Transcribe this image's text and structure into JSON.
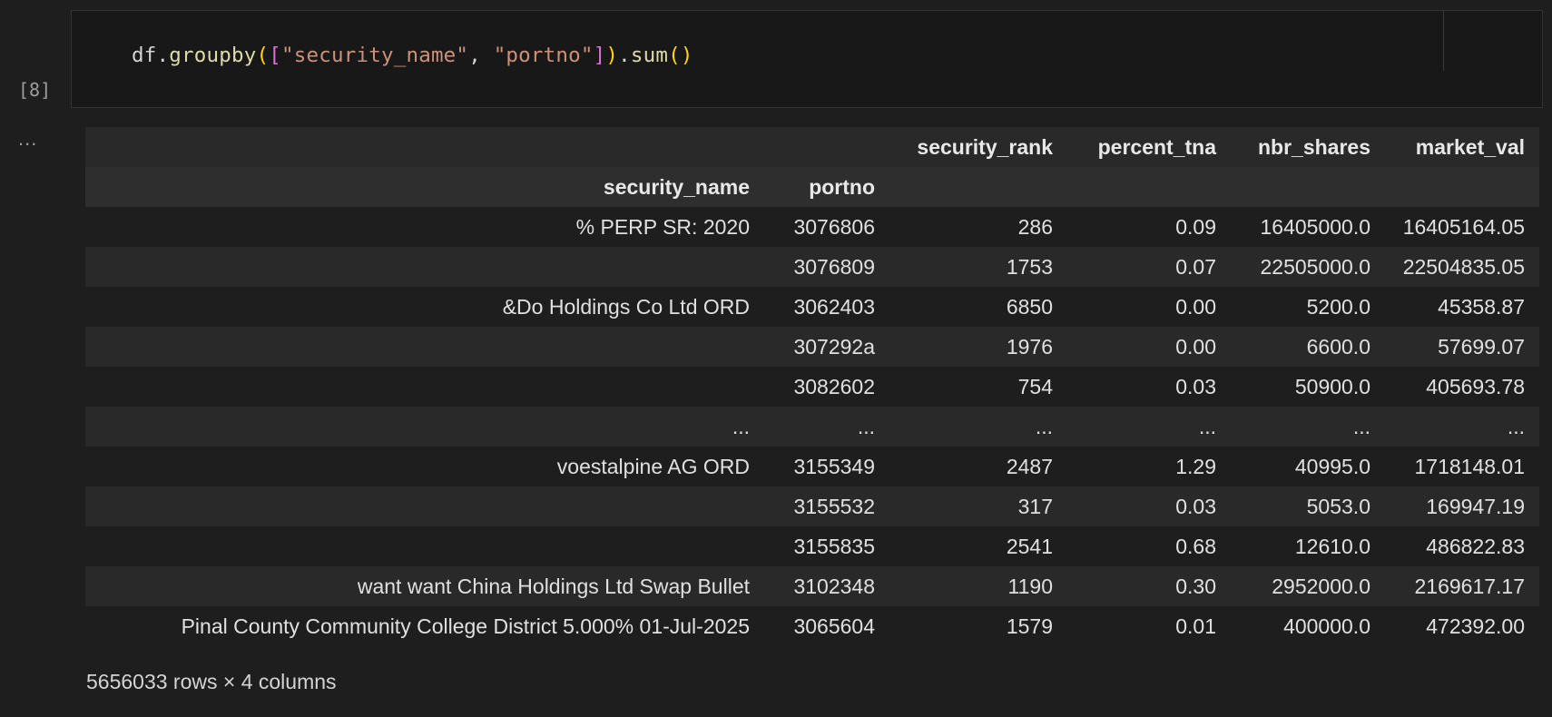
{
  "cell": {
    "execution_count": "[8]",
    "output_marker": "...",
    "code_tokens": {
      "t1": "df.",
      "t2": "groupby",
      "t3": "(",
      "t4": "[",
      "t5": "\"security_name\"",
      "t6": ", ",
      "t7": "\"portno\"",
      "t8": "]",
      "t9": ")",
      "t10": ".",
      "t11": "sum",
      "t12": "()"
    }
  },
  "dataframe": {
    "columns": [
      "security_rank",
      "percent_tna",
      "nbr_shares",
      "market_val"
    ],
    "index_names": [
      "security_name",
      "portno"
    ],
    "rows": [
      {
        "security_name": "% PERP SR: 2020",
        "portno": "3076806",
        "values": [
          "286",
          "0.09",
          "16405000.0",
          "16405164.05"
        ]
      },
      {
        "security_name": "",
        "portno": "3076809",
        "values": [
          "1753",
          "0.07",
          "22505000.0",
          "22504835.05"
        ]
      },
      {
        "security_name": "&Do Holdings Co Ltd ORD",
        "portno": "3062403",
        "values": [
          "6850",
          "0.00",
          "5200.0",
          "45358.87"
        ]
      },
      {
        "security_name": "",
        "portno": "307292a",
        "values": [
          "1976",
          "0.00",
          "6600.0",
          "57699.07"
        ]
      },
      {
        "security_name": "",
        "portno": "3082602",
        "values": [
          "754",
          "0.03",
          "50900.0",
          "405693.78"
        ]
      },
      {
        "security_name": "...",
        "portno": "...",
        "values": [
          "...",
          "...",
          "...",
          "..."
        ]
      },
      {
        "security_name": "voestalpine AG ORD",
        "portno": "3155349",
        "values": [
          "2487",
          "1.29",
          "40995.0",
          "1718148.01"
        ]
      },
      {
        "security_name": "",
        "portno": "3155532",
        "values": [
          "317",
          "0.03",
          "5053.0",
          "169947.19"
        ]
      },
      {
        "security_name": "",
        "portno": "3155835",
        "values": [
          "2541",
          "0.68",
          "12610.0",
          "486822.83"
        ]
      },
      {
        "security_name": "want want China Holdings Ltd Swap Bullet",
        "portno": "3102348",
        "values": [
          "1190",
          "0.30",
          "2952000.0",
          "2169617.17"
        ]
      },
      {
        "security_name": "Pinal County Community College District 5.000% 01-Jul-2025",
        "portno": "3065604",
        "values": [
          "1579",
          "0.01",
          "400000.0",
          "472392.00"
        ]
      }
    ],
    "shape_text": "5656033 rows × 4 columns"
  }
}
